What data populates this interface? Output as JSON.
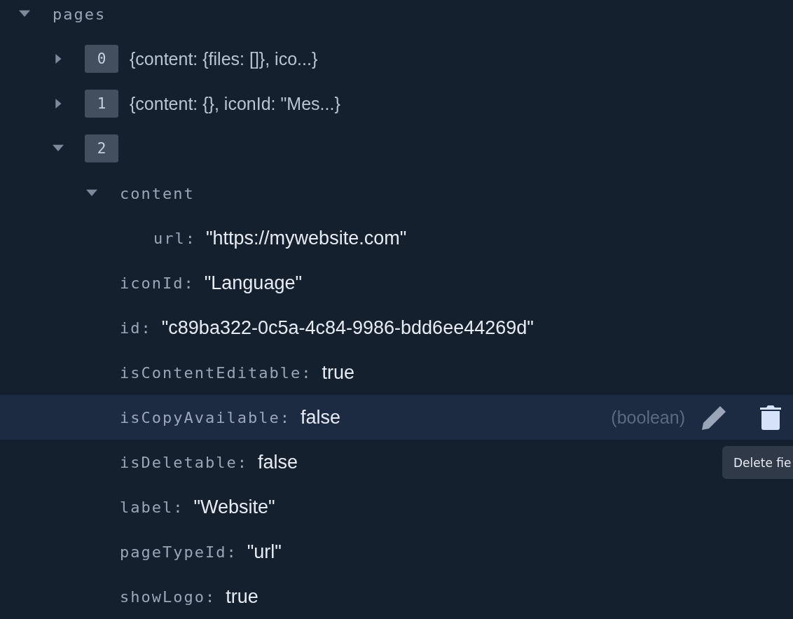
{
  "tree": {
    "key": "pages",
    "expanded": true,
    "children": [
      {
        "index": "0",
        "expanded": false,
        "preview": "{content: {files: []}, ico...}"
      },
      {
        "index": "1",
        "expanded": false,
        "preview": "{content: {}, iconId: \"Mes...}"
      },
      {
        "index": "2",
        "expanded": true,
        "children": [
          {
            "key": "content",
            "expanded": true,
            "selected": false,
            "children": [
              {
                "key": "url:",
                "value": "\"https://mywebsite.com\""
              }
            ]
          },
          {
            "key": "iconId:",
            "value": "\"Language\"",
            "selected": false
          },
          {
            "key": "id:",
            "value": "\"c89ba322-0c5a-4c84-9986-bdd6ee44269d\"",
            "selected": false
          },
          {
            "key": "isContentEditable:",
            "value": "true",
            "selected": false
          },
          {
            "key": "isCopyAvailable:",
            "value": "false",
            "selected": true,
            "type_hint": "(boolean)"
          },
          {
            "key": "isDeletable:",
            "value": "false",
            "selected": false
          },
          {
            "key": "label:",
            "value": "\"Website\"",
            "selected": false
          },
          {
            "key": "pageTypeId:",
            "value": "\"url\"",
            "selected": false
          },
          {
            "key": "showLogo:",
            "value": "true",
            "selected": false
          }
        ]
      }
    ]
  },
  "tooltip": {
    "text": "Delete fie"
  }
}
